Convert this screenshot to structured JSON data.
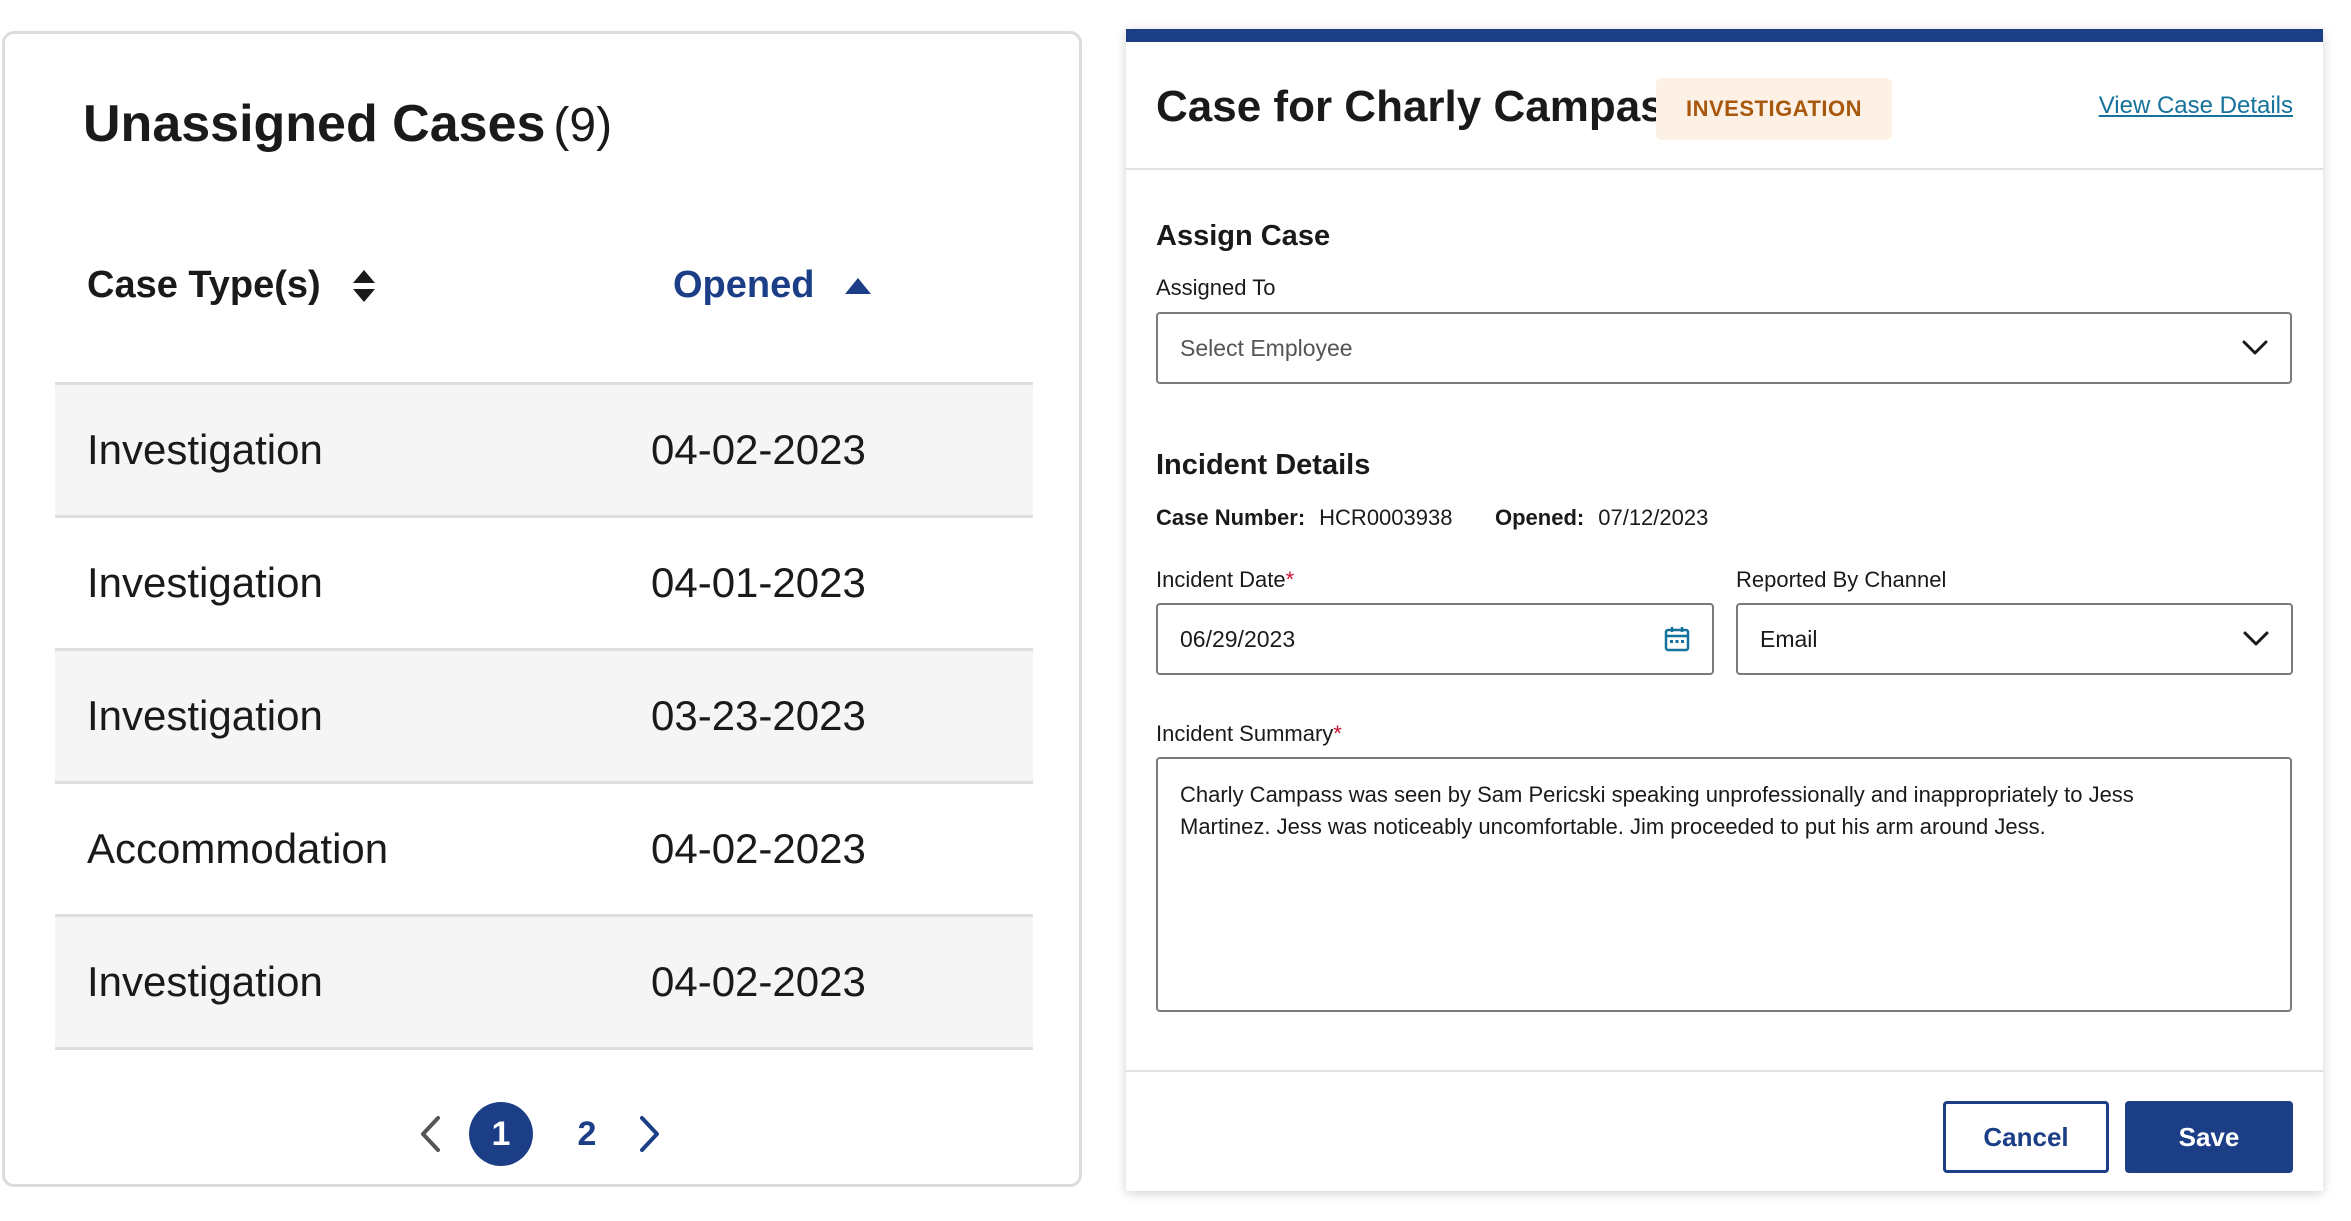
{
  "left": {
    "title": "Unassigned Cases",
    "count": "(9)",
    "columns": {
      "case_type": "Case Type(s)",
      "opened": "Opened"
    },
    "rows": [
      {
        "type": "Investigation",
        "opened": "04-02-2023"
      },
      {
        "type": "Investigation",
        "opened": "04-01-2023"
      },
      {
        "type": "Investigation",
        "opened": "03-23-2023"
      },
      {
        "type": "Accommodation",
        "opened": "04-02-2023"
      },
      {
        "type": "Investigation",
        "opened": "04-02-2023"
      }
    ],
    "pagination": {
      "pages": [
        "1",
        "2"
      ],
      "current": "1"
    }
  },
  "right": {
    "title": "Case for Charly Campass",
    "badge": "INVESTIGATION",
    "view_link": "View Case Details",
    "assign": {
      "section_title": "Assign Case",
      "assigned_to_label": "Assigned To",
      "assigned_to_placeholder": "Select Employee"
    },
    "incident": {
      "section_title": "Incident Details",
      "case_number_label": "Case Number:",
      "case_number": "HCR0003938",
      "opened_label": "Opened:",
      "opened": "07/12/2023",
      "incident_date_label": "Incident Date",
      "incident_date": "06/29/2023",
      "channel_label": "Reported By Channel",
      "channel": "Email",
      "summary_label": "Incident Summary",
      "summary": "Charly Campass was seen by Sam Pericski speaking unprofessionally and inappropriately to Jess\nMartinez. Jess was noticeably uncomfortable. Jim proceeded to put his arm around Jess."
    },
    "buttons": {
      "cancel": "Cancel",
      "save": "Save"
    }
  },
  "colors": {
    "primary": "#1b3e86",
    "badge_bg": "#fdf1e6",
    "badge_text": "#a8580c",
    "link": "#14729c",
    "required": "#c8102e"
  }
}
